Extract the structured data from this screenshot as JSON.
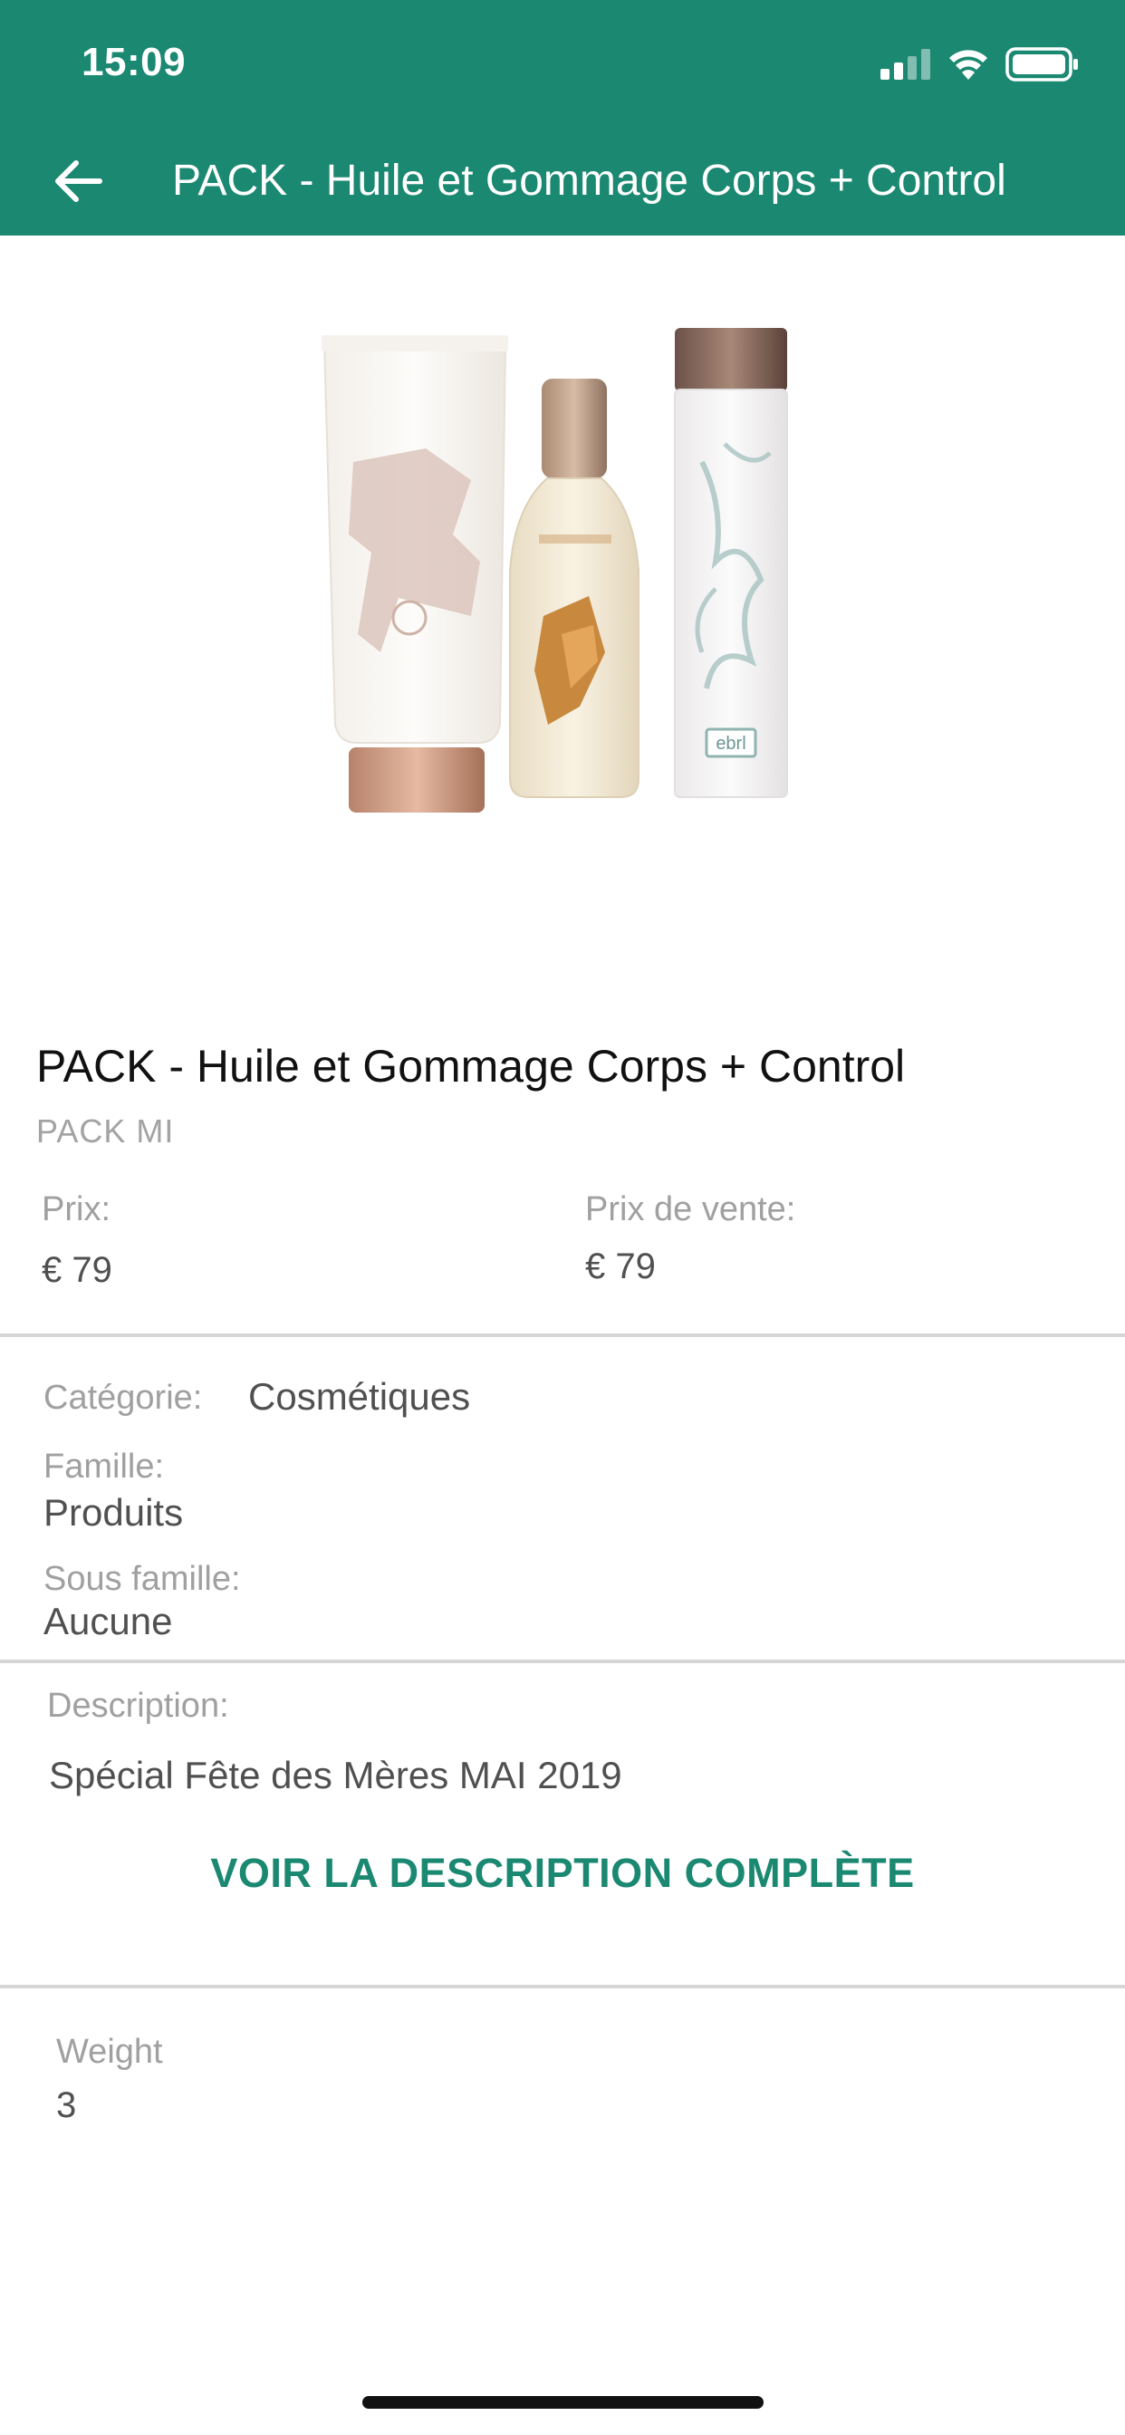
{
  "status_bar": {
    "time": "15:09"
  },
  "nav": {
    "title": "PACK - Huile et Gommage Corps + Control"
  },
  "product": {
    "title": "PACK - Huile et Gommage Corps + Control",
    "reference": "PACK MI",
    "price": {
      "label": "Prix:",
      "value": "€ 79"
    },
    "sale_price": {
      "label": "Prix de vente:",
      "value": "€ 79"
    },
    "category": {
      "label": "Catégorie:",
      "value": "Cosmétiques"
    },
    "family": {
      "label": "Famille:",
      "value": "Produits"
    },
    "subfamily": {
      "label": "Sous famille:",
      "value": "Aucune"
    },
    "description": {
      "label": "Description:",
      "value": "Spécial Fête des Mères MAI 2019"
    },
    "see_full_description": "VOIR LA DESCRIPTION COMPLÈTE",
    "weight": {
      "label": "Weight",
      "value": "3"
    },
    "image_labels": {
      "bottle3_brand": "ebrl"
    }
  },
  "colors": {
    "header": "#1b8871",
    "accent": "#1b8871"
  }
}
